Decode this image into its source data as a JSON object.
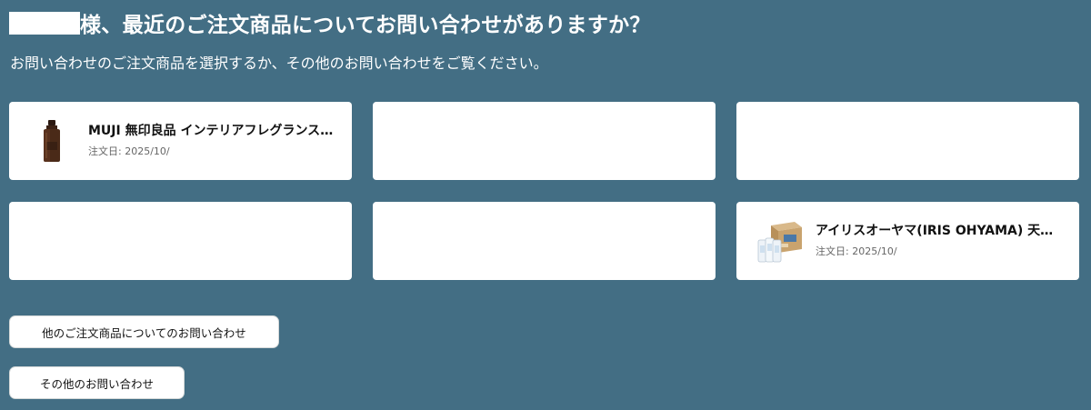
{
  "header": {
    "title_suffix": "様、最近のご注文商品についてお問い合わせがありますか？",
    "subtitle": "お問い合わせのご注文商品を選択するか、その他のお問い合わせをご覧ください。"
  },
  "orders": [
    {
      "title": "MUJI 無印良品 インテリアフレグランスオイル",
      "date": "注文日: 2025/10/",
      "icon": "fragrance-bottle-icon"
    },
    {
      "title": "アイリスオーヤマ(IRIS OHYAMA) 天然水",
      "date": "注文日: 2025/10/",
      "icon": "water-box-icon"
    }
  ],
  "buttons": {
    "other_orders": "他のご注文商品についてのお問い合わせ",
    "other_inquiries": "その他のお問い合わせ"
  },
  "colors": {
    "background": "#436e84",
    "card": "#ffffff"
  }
}
